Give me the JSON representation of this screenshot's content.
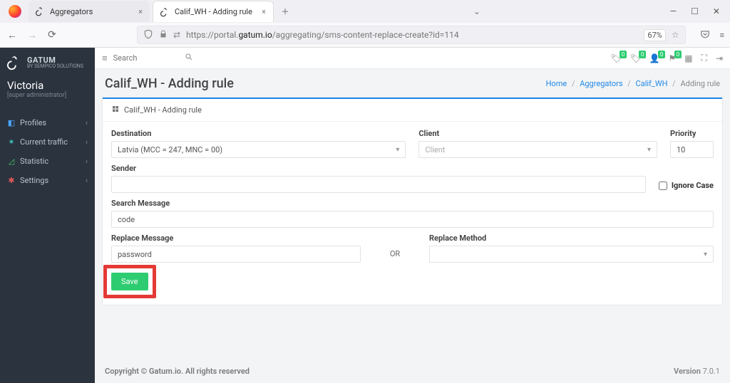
{
  "browser": {
    "tabs": [
      {
        "title": "Aggregators",
        "active": false
      },
      {
        "title": "Calif_WH - Adding rule",
        "active": true
      }
    ],
    "url_prefix": "https://portal.",
    "url_host": "gatum.io",
    "url_path": "/aggregating/sms-content-replace-create?id=114",
    "zoom": "67%"
  },
  "brand": {
    "name": "GATUM",
    "sub": "BY SEMPICO SOLUTIONS"
  },
  "user": {
    "name": "Victoria",
    "role": "[super administrator]"
  },
  "sidebar": {
    "items": [
      {
        "label": "Profiles"
      },
      {
        "label": "Current traffic"
      },
      {
        "label": "Statistic"
      },
      {
        "label": "Settings"
      }
    ]
  },
  "topbar": {
    "search_placeholder": "Search",
    "badges": [
      "0",
      "0",
      "0",
      "0"
    ]
  },
  "page": {
    "title": "Calif_WH - Adding rule",
    "panel_title": "Calif_WH - Adding rule",
    "breadcrumbs": {
      "home": "Home",
      "aggregators": "Aggregators",
      "ent": "Calif_WH",
      "current": "Adding rule"
    }
  },
  "form": {
    "labels": {
      "destination": "Destination",
      "client": "Client",
      "priority": "Priority",
      "sender": "Sender",
      "ignore": "Ignore Case",
      "search": "Search Message",
      "replace": "Replace Message",
      "or": "OR",
      "method": "Replace Method"
    },
    "values": {
      "destination": "Latvia (MCC = 247, MNC = 00)",
      "client_placeholder": "Client",
      "priority": "10",
      "search": "code",
      "replace": "password"
    },
    "save_label": "Save"
  },
  "footer": {
    "copyright": "Copyright © Gatum.io. All rights reserved",
    "version_label": "Version ",
    "version": "7.0.1"
  }
}
